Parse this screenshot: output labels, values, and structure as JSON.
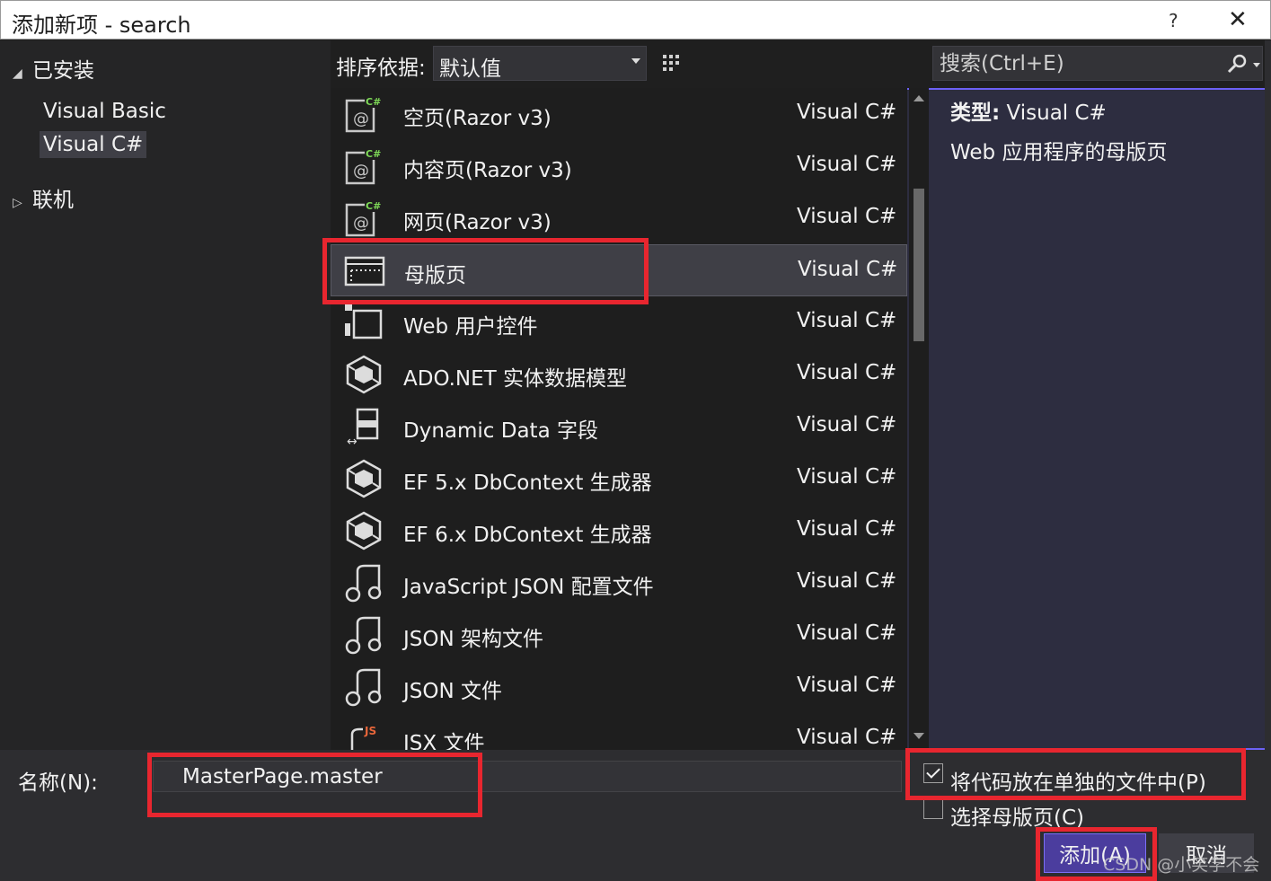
{
  "window": {
    "title": "添加新项 - search",
    "help": "?",
    "close": "✕"
  },
  "tree": {
    "installed": "已安装",
    "children": [
      "Visual Basic",
      "Visual C#"
    ],
    "online": "联机"
  },
  "toolbar": {
    "sort_label": "排序依据:",
    "sort_value": "默认值"
  },
  "search": {
    "placeholder": "搜索(Ctrl+E)"
  },
  "items": [
    {
      "name": "空页(Razor v3)",
      "lang": "Visual C#",
      "icon": "razor-page-icon"
    },
    {
      "name": "内容页(Razor v3)",
      "lang": "Visual C#",
      "icon": "razor-page-icon"
    },
    {
      "name": "网页(Razor v3)",
      "lang": "Visual C#",
      "icon": "razor-page-icon"
    },
    {
      "name": "母版页",
      "lang": "Visual C#",
      "icon": "master-page-icon",
      "selected": true
    },
    {
      "name": "Web 用户控件",
      "lang": "Visual C#",
      "icon": "user-control-icon"
    },
    {
      "name": "ADO.NET 实体数据模型",
      "lang": "Visual C#",
      "icon": "entity-model-icon"
    },
    {
      "name": "Dynamic Data 字段",
      "lang": "Visual C#",
      "icon": "dynamic-data-icon"
    },
    {
      "name": "EF 5.x DbContext 生成器",
      "lang": "Visual C#",
      "icon": "entity-model-icon"
    },
    {
      "name": "EF 6.x DbContext 生成器",
      "lang": "Visual C#",
      "icon": "entity-model-icon"
    },
    {
      "name": "JavaScript JSON 配置文件",
      "lang": "Visual C#",
      "icon": "json-file-icon"
    },
    {
      "name": "JSON 架构文件",
      "lang": "Visual C#",
      "icon": "json-file-icon"
    },
    {
      "name": "JSON 文件",
      "lang": "Visual C#",
      "icon": "json-file-icon"
    },
    {
      "name": "JSX 文件",
      "lang": "Visual C#",
      "icon": "jsx-file-icon"
    }
  ],
  "details": {
    "type_label": "类型:",
    "type_value": "Visual C#",
    "description": "Web 应用程序的母版页"
  },
  "name": {
    "label": "名称(N):",
    "value": "MasterPage.master"
  },
  "options": {
    "separate_code": "将代码放在单独的文件中(P)",
    "select_master": "选择母版页(C)"
  },
  "buttons": {
    "add": "添加(A)",
    "cancel": "取消"
  },
  "watermark": "CSDN @小笑学不会",
  "colors": {
    "accent": "#6c61f5",
    "highlight": "#e8262f",
    "primary_button": "#4b3d9e"
  }
}
